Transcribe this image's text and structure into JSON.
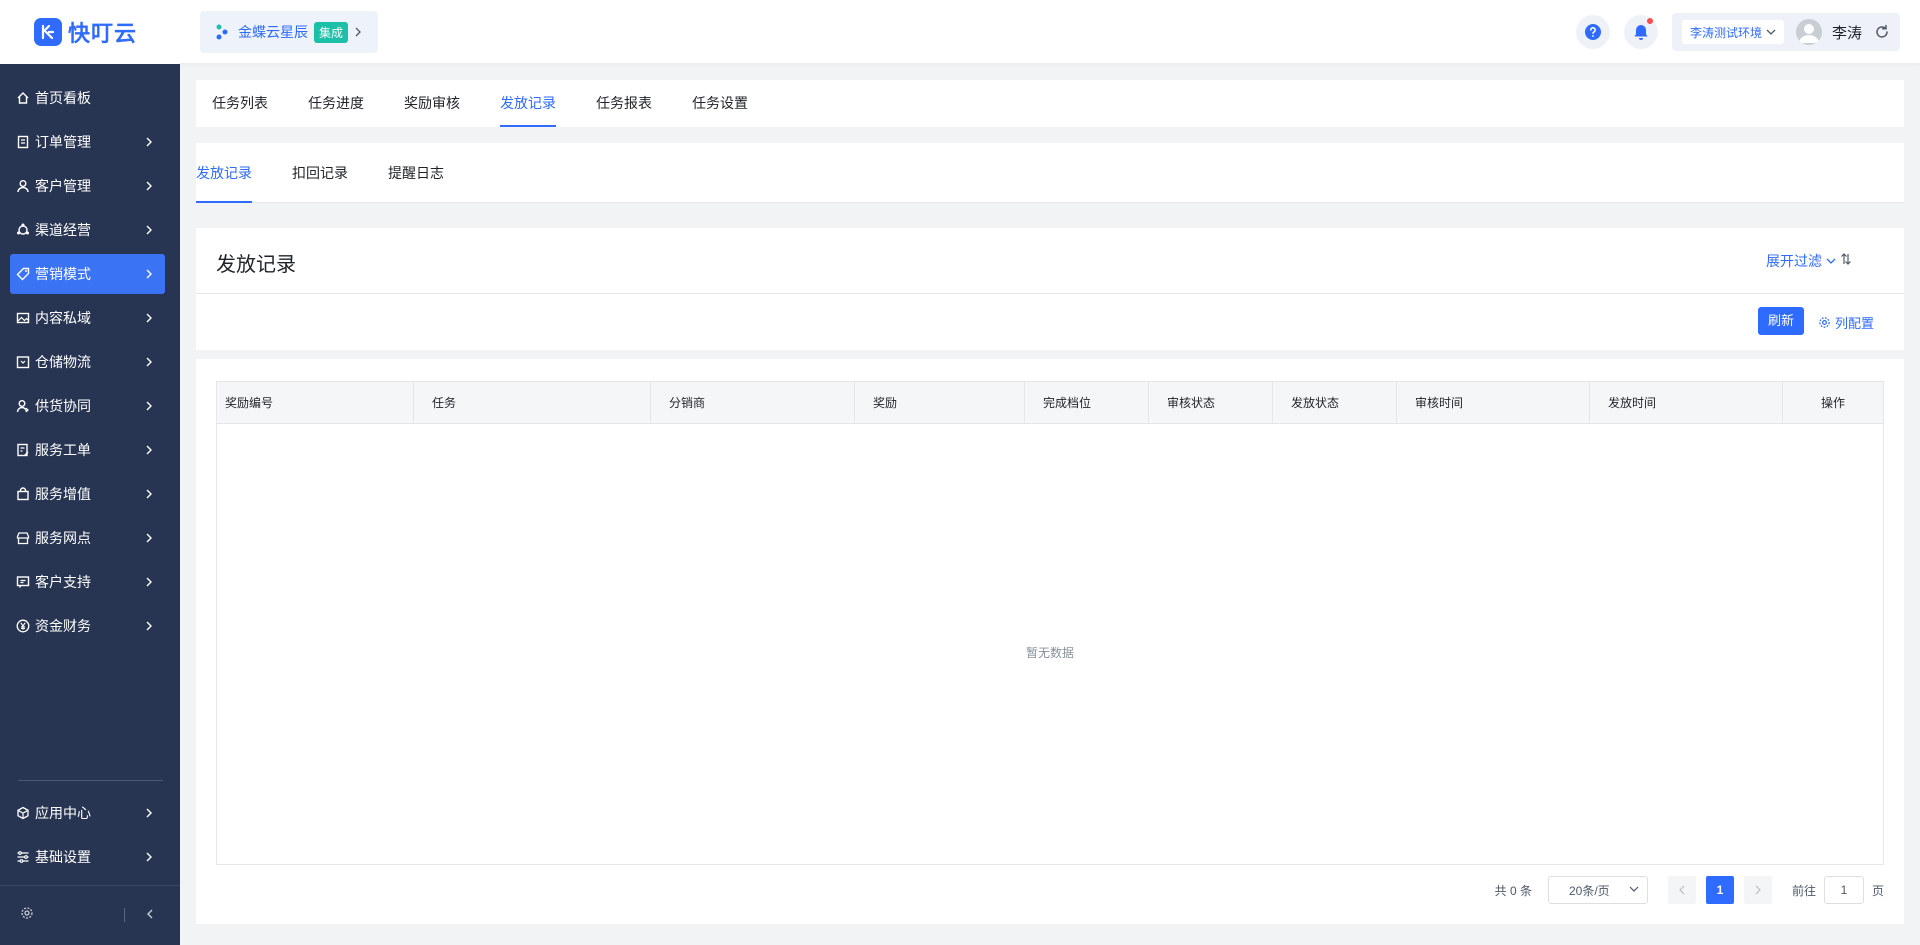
{
  "brand": {
    "name": "快叮云"
  },
  "integration": {
    "label": "金蝶云星辰",
    "badge": "集成"
  },
  "header": {
    "env": "李涛测试环境",
    "user": "李涛"
  },
  "sidebar": {
    "items": [
      {
        "label": "首页看板",
        "icon": "home-icon",
        "chevron": false
      },
      {
        "label": "订单管理",
        "icon": "order-icon",
        "chevron": true
      },
      {
        "label": "客户管理",
        "icon": "user-icon",
        "chevron": true
      },
      {
        "label": "渠道经营",
        "icon": "channel-icon",
        "chevron": true
      },
      {
        "label": "营销模式",
        "icon": "tag-icon",
        "chevron": true,
        "active": true
      },
      {
        "label": "内容私域",
        "icon": "image-icon",
        "chevron": true
      },
      {
        "label": "仓储物流",
        "icon": "box-icon",
        "chevron": true
      },
      {
        "label": "供货协同",
        "icon": "supply-icon",
        "chevron": true
      },
      {
        "label": "服务工单",
        "icon": "ticket-icon",
        "chevron": true
      },
      {
        "label": "服务增值",
        "icon": "bag-icon",
        "chevron": true
      },
      {
        "label": "服务网点",
        "icon": "store-icon",
        "chevron": true
      },
      {
        "label": "客户支持",
        "icon": "support-icon",
        "chevron": true
      },
      {
        "label": "资金财务",
        "icon": "yen-icon",
        "chevron": true
      }
    ],
    "bottom_items": [
      {
        "label": "应用中心",
        "icon": "cube-icon"
      },
      {
        "label": "基础设置",
        "icon": "settings-icon"
      }
    ]
  },
  "main_tabs": [
    "任务列表",
    "任务进度",
    "奖励审核",
    "发放记录",
    "任务报表",
    "任务设置"
  ],
  "main_tab_active": "发放记录",
  "sub_tabs": [
    "发放记录",
    "扣回记录",
    "提醒日志"
  ],
  "sub_tab_active": "发放记录",
  "section": {
    "title": "发放记录",
    "filter_label": "展开过滤",
    "refresh_label": "刷新",
    "column_config_label": "列配置"
  },
  "table": {
    "columns": [
      "奖励编号",
      "任务",
      "分销商",
      "奖励",
      "完成档位",
      "审核状态",
      "发放状态",
      "审核时间",
      "发放时间",
      "操作"
    ],
    "empty_text": "暂无数据"
  },
  "pagination": {
    "total": "共 0 条",
    "page_size": "20条/页",
    "current_page": "1",
    "goto_label": "前往",
    "goto_value": "1",
    "goto_suffix": "页"
  },
  "colors": {
    "accent": "#2f6bff",
    "sidebar_bg": "#283552",
    "badge": "#1dbfa8"
  }
}
